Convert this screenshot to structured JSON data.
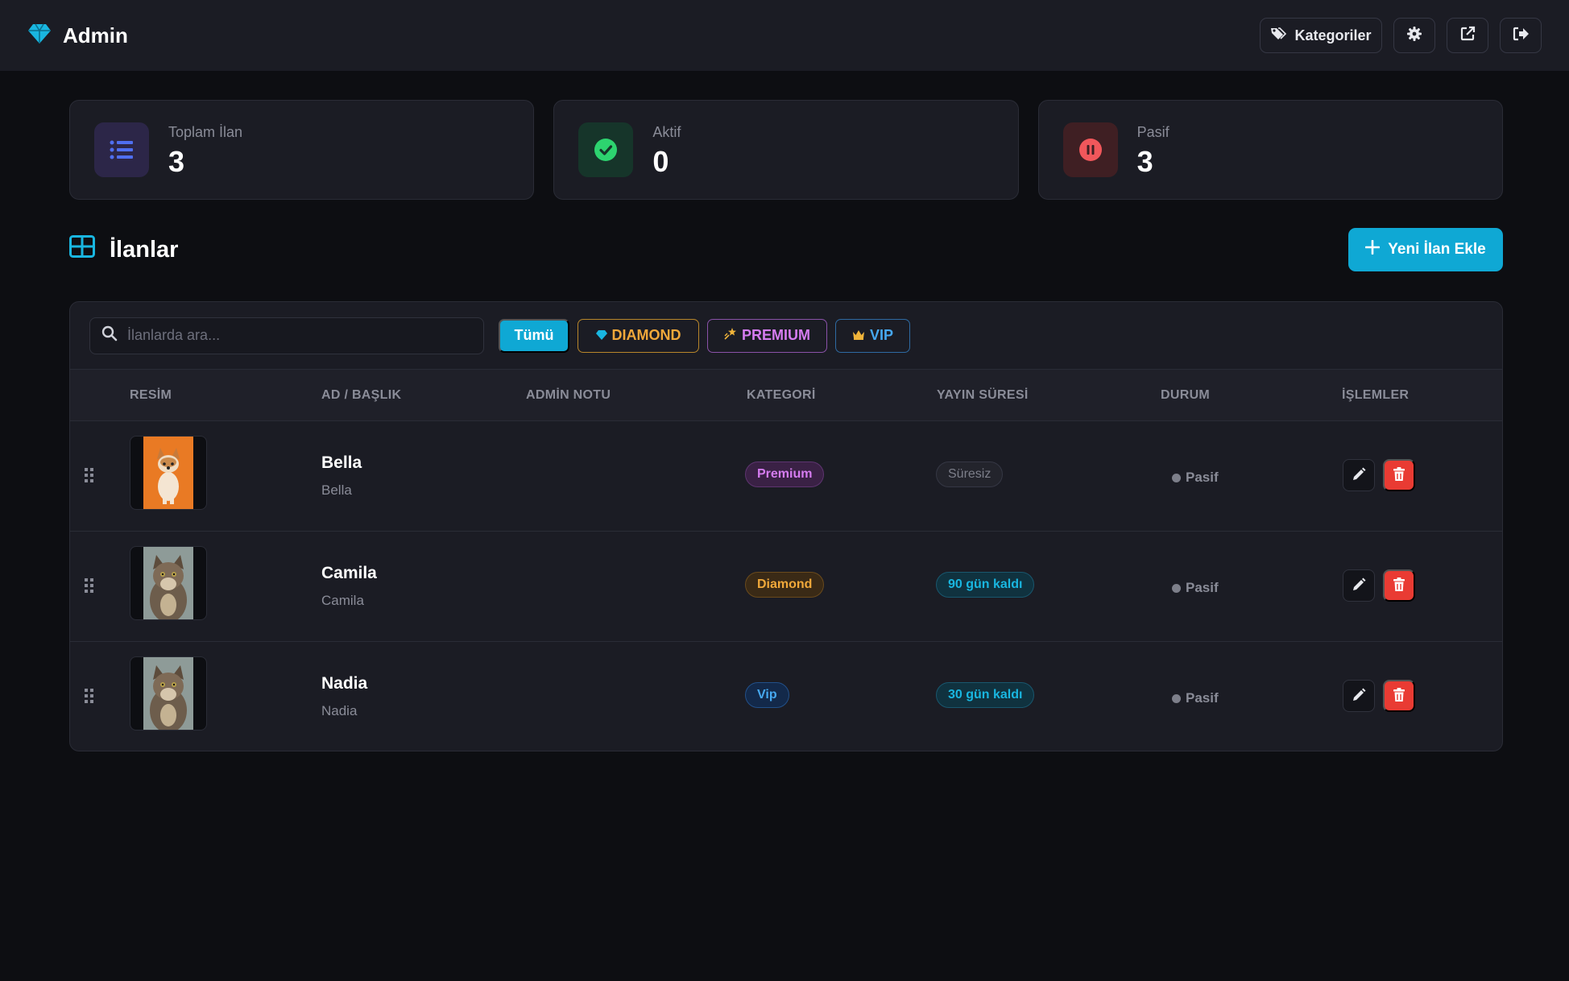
{
  "header": {
    "brand": "Admin",
    "categories_label": "Kategoriler"
  },
  "stats": [
    {
      "label": "Toplam İlan",
      "value": "3"
    },
    {
      "label": "Aktif",
      "value": "0"
    },
    {
      "label": "Pasif",
      "value": "3"
    }
  ],
  "section": {
    "title": "İlanlar",
    "add_button": "Yeni İlan Ekle"
  },
  "filters": {
    "search_placeholder": "İlanlarda ara...",
    "all": "Tümü",
    "diamond": "DIAMOND",
    "premium": "PREMIUM",
    "vip": "VIP"
  },
  "table": {
    "columns": [
      "RESİM",
      "AD / BAŞLIK",
      "ADMİN NOTU",
      "KATEGORİ",
      "YAYIN SÜRESİ",
      "DURUM",
      "İŞLEMLER"
    ],
    "rows": [
      {
        "name": "Bella",
        "subtitle": "Bella",
        "category": "Premium",
        "duration": "Süresiz",
        "status": "Pasif"
      },
      {
        "name": "Camila",
        "subtitle": "Camila",
        "category": "Diamond",
        "duration": "90 gün kaldı",
        "status": "Pasif"
      },
      {
        "name": "Nadia",
        "subtitle": "Nadia",
        "category": "Vip",
        "duration": "30 gün kaldı",
        "status": "Pasif"
      }
    ]
  },
  "colors": {
    "accent": "#0fa8d4",
    "background": "#0d0e12",
    "surface": "#1b1c24",
    "danger": "#e93b33",
    "diamond": "#f0a83a",
    "premium": "#d57cf0",
    "vip": "#46a8f0"
  },
  "icons": {
    "brand": "diamond-icon",
    "categories": "tags-icon",
    "settings": "gear-icon",
    "external": "external-link-icon",
    "logout": "logout-icon",
    "total": "list-icon",
    "active": "check-circle-icon",
    "passive": "pause-circle-icon",
    "section": "grid-icon",
    "search": "search-icon",
    "drag": "drag-handle-icon",
    "edit": "pencil-icon",
    "delete": "trash-icon"
  }
}
